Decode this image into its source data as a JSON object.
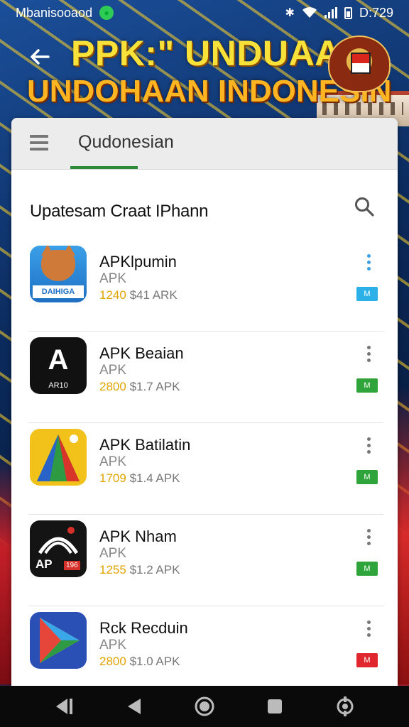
{
  "status_bar": {
    "carrier": "Mbanisooaod",
    "time": "D:729"
  },
  "header": {
    "title_line1": "PPK:\" UNDUAAN",
    "title_line2": "UNDOHAAN INDONESIN"
  },
  "tabs": [
    {
      "label": "Qudonesian",
      "active": true
    }
  ],
  "section_title": "Upatesam Craat IPhann",
  "apps": [
    {
      "name": "APKlpumin",
      "type": "APK",
      "rating": "1240",
      "meta_rest": "$41 ARK",
      "icon": "fox-icon",
      "badge": "M",
      "badge_color": "#2bb0e8",
      "icon_label": "DAIHIGA"
    },
    {
      "name": "APK Beaian",
      "type": "APK",
      "rating": "2800",
      "meta_rest": "$1.7 APK",
      "icon": "black-a-icon",
      "badge": "M",
      "badge_color": "#2ea43a",
      "icon_label": "AR10"
    },
    {
      "name": "APK Batilatin",
      "type": "APK",
      "rating": "1709",
      "meta_rest": "$1.4 APK",
      "icon": "triangle-icon",
      "badge": "M",
      "badge_color": "#2ea43a"
    },
    {
      "name": "APK Nham",
      "type": "APK",
      "rating": "1255",
      "meta_rest": "$1.2 APK",
      "icon": "black-ap-icon",
      "badge": "M",
      "badge_color": "#2ea43a",
      "icon_label": "AP",
      "icon_tag": "196"
    },
    {
      "name": "Rck Recduin",
      "type": "APK",
      "rating": "2800",
      "meta_rest": "$1.0 APK",
      "icon": "play-icon",
      "badge": "M",
      "badge_color": "#e0262e"
    }
  ],
  "colors": {
    "accent_green": "#2e8b3a",
    "rating_yellow": "#e1a400",
    "title_yellow": "#f8e23a",
    "title_orange": "#ffb422"
  }
}
